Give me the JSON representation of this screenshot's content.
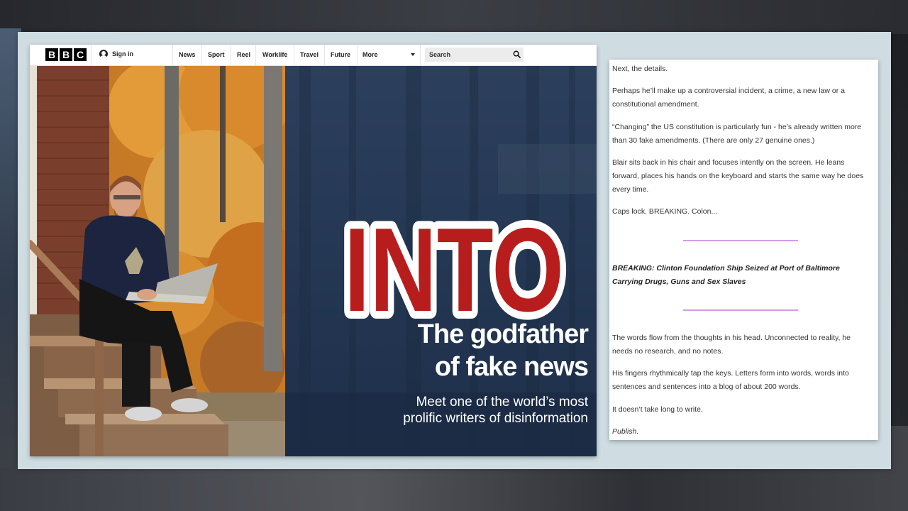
{
  "bbc": {
    "logo_letters": [
      "B",
      "B",
      "C"
    ],
    "sign_in": "Sign in",
    "nav": [
      "News",
      "Sport",
      "Reel",
      "Worklife",
      "Travel",
      "Future",
      "More"
    ],
    "search_placeholder": "Search"
  },
  "hero": {
    "overlay_word": "INTO",
    "headline": "The godfather\nof fake news",
    "subhead": "Meet one of the world’s most\nprolific writers of disinformation"
  },
  "article": {
    "p1": "Next, the details.",
    "p2": "Perhaps he’ll make up a controversial incident, a crime, a new law or a constitutional amendment.",
    "p3": "“Changing” the US constitution is particularly fun - he’s already written more than 30 fake amendments. (There are only 27 genuine ones.)",
    "p4": "Blair sits back in his chair and focuses intently on the screen. He leans forward, places his hands on the keyboard and starts the same way he does every time.",
    "p5": "Caps lock. BREAKING. Colon...",
    "breaking": "BREAKING: Clinton Foundation Ship Seized at Port of Baltimore Carrying Drugs, Guns and Sex Slaves",
    "p6": "The words flow from the thoughts in his head. Unconnected to reality, he needs no research, and no notes.",
    "p7": "His fingers rhythmically tap the keys. Letters form into words, words into sentences and sentences into a blog of about 200 words.",
    "p8": "It doesn’t take long to write.",
    "p9": "Publish."
  },
  "colors": {
    "overlay_red": "#b81d1d",
    "hero_navy": "#243753",
    "divider_pink": "#d59be6"
  }
}
